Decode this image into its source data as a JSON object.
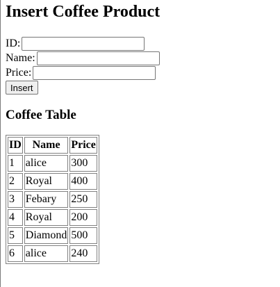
{
  "page": {
    "title": "Insert Coffee Product"
  },
  "form": {
    "id_label": "ID:",
    "name_label": "Name:",
    "price_label": "Price:",
    "id_value": "",
    "name_value": "",
    "price_value": "",
    "submit_label": "Insert"
  },
  "table_section": {
    "heading": "Coffee Table",
    "headers": [
      "ID",
      "Name",
      "Price"
    ],
    "rows": [
      [
        "1",
        "alice",
        "300"
      ],
      [
        "2",
        "Royal",
        "400"
      ],
      [
        "3",
        "Febary",
        "250"
      ],
      [
        "4",
        "Royal",
        "200"
      ],
      [
        "5",
        "Diamond",
        "500"
      ],
      [
        "6",
        "alice",
        "240"
      ]
    ]
  }
}
